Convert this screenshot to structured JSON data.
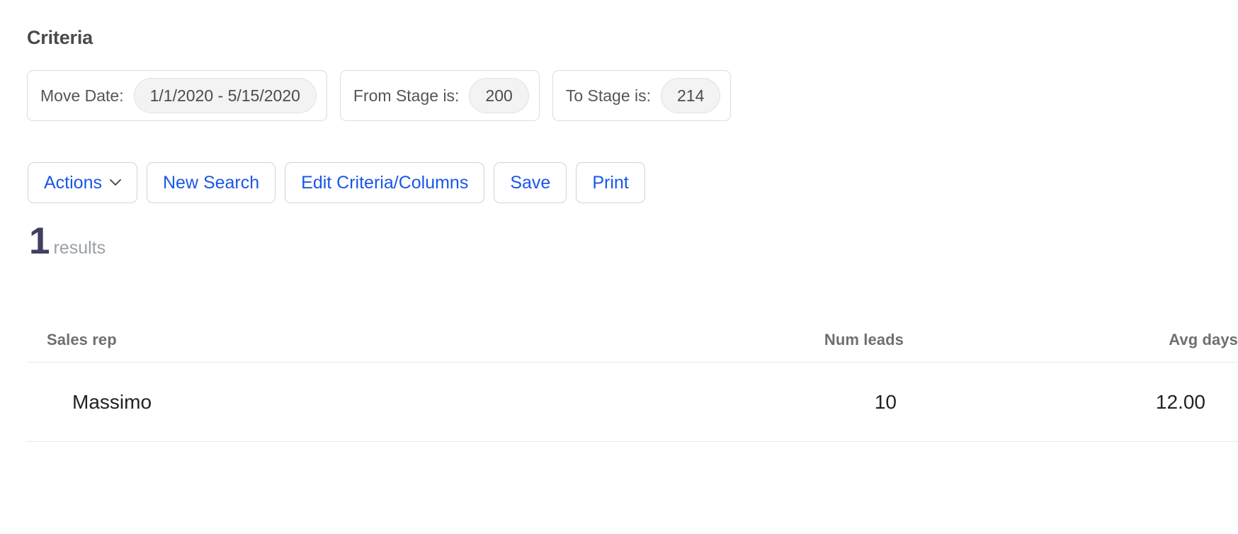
{
  "criteria": {
    "heading": "Criteria",
    "filters": [
      {
        "label": "Move Date:",
        "value": "1/1/2020 - 5/15/2020"
      },
      {
        "label": "From Stage is:",
        "value": "200"
      },
      {
        "label": "To Stage is:",
        "value": "214"
      }
    ]
  },
  "toolbar": {
    "actions_label": "Actions",
    "actions_icon": "chevron-down-icon",
    "new_search_label": "New Search",
    "edit_criteria_label": "Edit Criteria/Columns",
    "save_label": "Save",
    "print_label": "Print"
  },
  "results": {
    "count": "1",
    "word": "results"
  },
  "table": {
    "columns": [
      "Sales rep",
      "Num leads",
      "Avg days"
    ],
    "rows": [
      {
        "sales_rep": "Massimo",
        "num_leads": "10",
        "avg_days": "12.00"
      }
    ]
  },
  "colors": {
    "link": "#1a56e8",
    "count": "#3f4061",
    "muted": "#9aa0a6",
    "border": "#dcdcdc",
    "chip_bg": "#f3f3f3"
  }
}
